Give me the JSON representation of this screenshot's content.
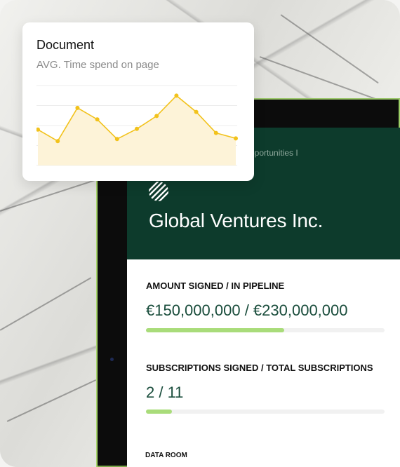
{
  "popup_card": {
    "title": "Document",
    "subtitle": "AVG. Time spend on page"
  },
  "chart_data": {
    "type": "area",
    "title": "",
    "x": [
      1,
      2,
      3,
      4,
      5,
      6,
      7,
      8,
      9,
      10,
      11
    ],
    "values": [
      5.3,
      3.6,
      8.5,
      6.8,
      3.9,
      5.4,
      7.3,
      10.3,
      7.9,
      4.8,
      4.0
    ],
    "ylim": [
      0,
      12
    ],
    "grid": true,
    "colors": {
      "line": "#f2c21b",
      "fill": "#fdf3d8",
      "grid": "#ececec"
    }
  },
  "hero": {
    "subtitle": "pportunities I",
    "company": "Global Ventures Inc."
  },
  "metrics": {
    "amount": {
      "label": "AMOUNT SIGNED / IN PIPELINE",
      "value": "€150,000,000 / €230,000,000",
      "progress": 0.58
    },
    "subscriptions": {
      "label": "SUBSCRIPTIONS SIGNED / TOTAL SUBSCRIPTIONS",
      "value": "2 / 11",
      "progress": 0.11
    },
    "data_room": {
      "label": "DATA ROOM"
    }
  },
  "colors": {
    "brand_dark_green": "#0d3b2c",
    "progress_green": "#a9dc7a",
    "accent_yellow": "#f2c21b"
  }
}
